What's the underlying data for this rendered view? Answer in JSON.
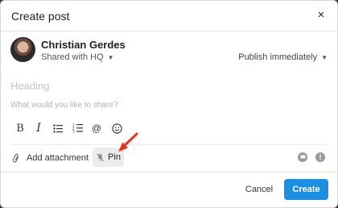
{
  "dialog": {
    "title": "Create post",
    "close_label": "×"
  },
  "author": {
    "name": "Christian Gerdes",
    "shared_with": "Shared with HQ"
  },
  "publish": {
    "label": "Publish immediately"
  },
  "composer": {
    "heading_placeholder": "Heading",
    "body_placeholder": "What would you like to share?"
  },
  "toolbar": {
    "bold": "B",
    "italic": "I",
    "mention": "@"
  },
  "actions": {
    "attach_label": "Add attachment",
    "pin_label": "Pin"
  },
  "footer": {
    "cancel_label": "Cancel",
    "create_label": "Create"
  },
  "colors": {
    "primary": "#1a8fe3",
    "annotation_arrow": "#e8321c"
  }
}
